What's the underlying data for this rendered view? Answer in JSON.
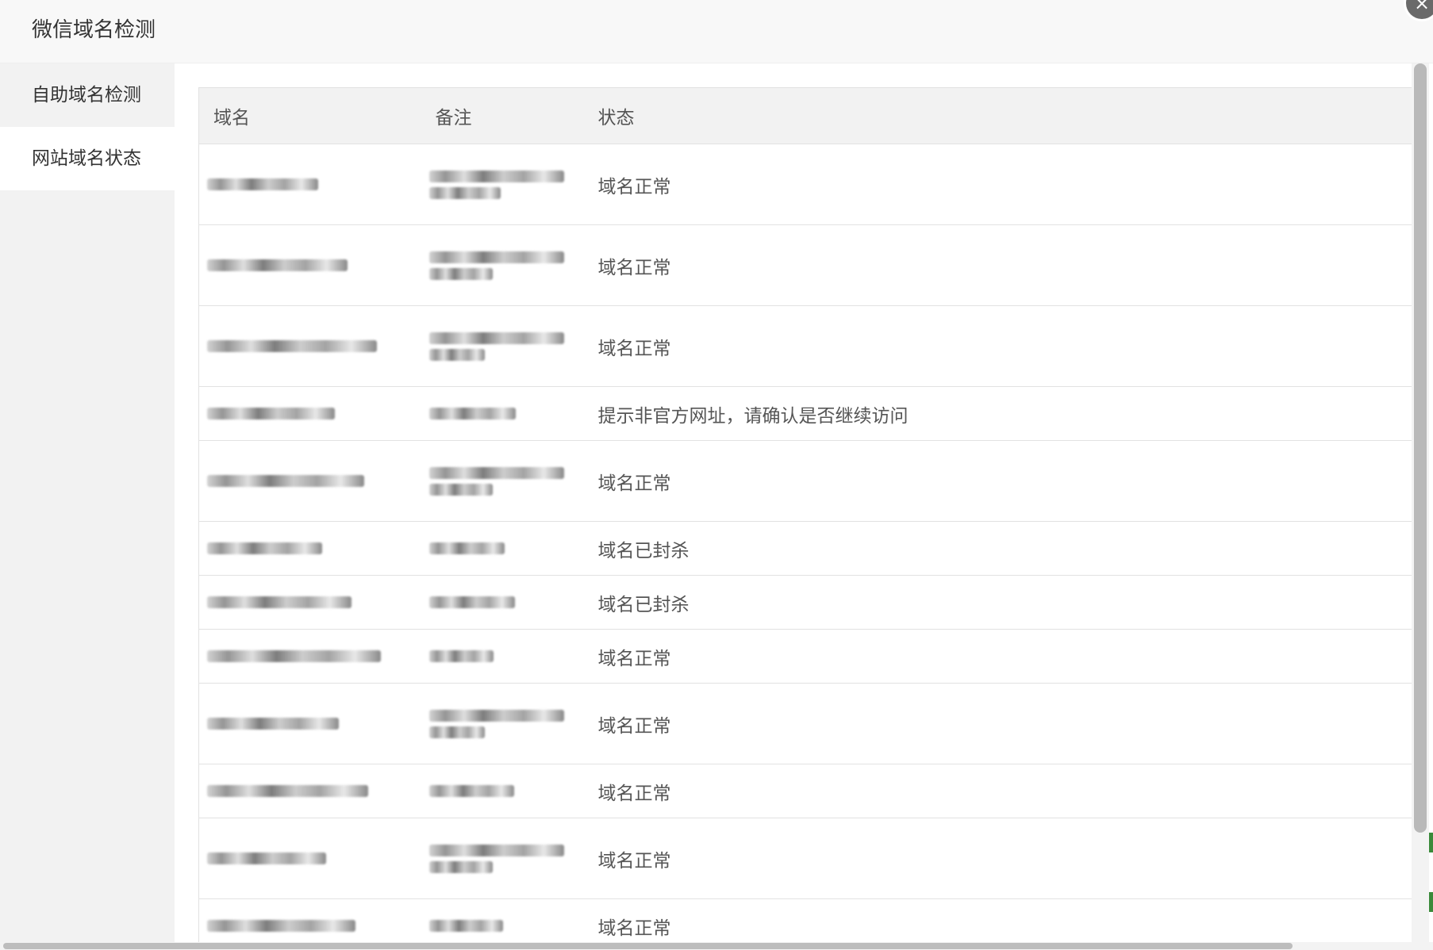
{
  "dialog": {
    "title": "微信域名检测",
    "close_label": "×"
  },
  "tabs": [
    {
      "label": "自助域名检测",
      "active": false
    },
    {
      "label": "网站域名状态",
      "active": true
    }
  ],
  "table": {
    "columns": [
      "域名",
      "备注",
      "状态"
    ],
    "rows": [
      {
        "domain_redacted": true,
        "remark_lines": 2,
        "status": "域名正常"
      },
      {
        "domain_redacted": true,
        "remark_lines": 2,
        "status": "域名正常"
      },
      {
        "domain_redacted": true,
        "remark_lines": 2,
        "status": "域名正常"
      },
      {
        "domain_redacted": true,
        "remark_lines": 1,
        "status": "提示非官方网址，请确认是否继续访问"
      },
      {
        "domain_redacted": true,
        "remark_lines": 2,
        "status": "域名正常"
      },
      {
        "domain_redacted": true,
        "remark_lines": 1,
        "status": "域名已封杀"
      },
      {
        "domain_redacted": true,
        "remark_lines": 1,
        "status": "域名已封杀"
      },
      {
        "domain_redacted": true,
        "remark_lines": 1,
        "status": "域名正常"
      },
      {
        "domain_redacted": true,
        "remark_lines": 2,
        "status": "域名正常"
      },
      {
        "domain_redacted": true,
        "remark_lines": 1,
        "status": "域名正常"
      },
      {
        "domain_redacted": true,
        "remark_lines": 2,
        "status": "域名正常"
      },
      {
        "domain_redacted": true,
        "remark_lines": 1,
        "status": "域名正常"
      }
    ]
  }
}
